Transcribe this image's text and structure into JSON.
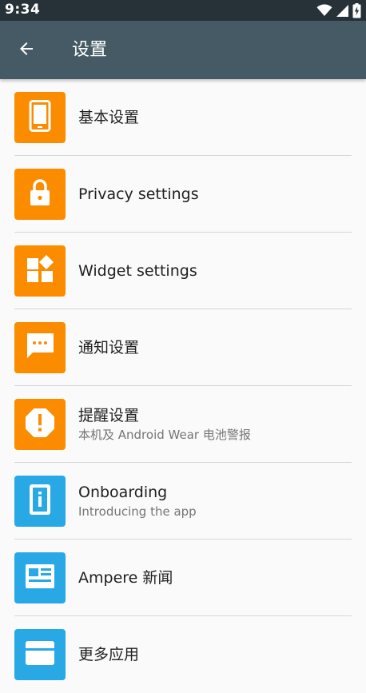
{
  "status_bar": {
    "time": "9:34",
    "icons": [
      "wifi-icon",
      "cell-signal-icon",
      "battery-charging-icon"
    ]
  },
  "app_bar": {
    "title": "设置",
    "back_icon": "arrow-back-icon"
  },
  "colors": {
    "status_bar": "#263238",
    "app_bar": "#455a64",
    "orange_tile": "#fb8c00",
    "blue_tile": "#29a8e6",
    "background": "#fafafa"
  },
  "items": [
    {
      "title": "基本设置",
      "subtitle": "",
      "icon": "phone-icon",
      "tile_color": "#fb8c00"
    },
    {
      "title": "Privacy settings",
      "subtitle": "",
      "icon": "lock-icon",
      "tile_color": "#fb8c00"
    },
    {
      "title": "Widget settings",
      "subtitle": "",
      "icon": "widgets-icon",
      "tile_color": "#fb8c00"
    },
    {
      "title": "通知设置",
      "subtitle": "",
      "icon": "chat-bubble-icon",
      "tile_color": "#fb8c00"
    },
    {
      "title": "提醒设置",
      "subtitle": "本机及 Android Wear 电池警报",
      "icon": "alert-octagon-icon",
      "tile_color": "#fb8c00"
    },
    {
      "title": "Onboarding",
      "subtitle": "Introducing the app",
      "icon": "info-phone-icon",
      "tile_color": "#29a8e6"
    },
    {
      "title": "Ampere 新闻",
      "subtitle": "",
      "icon": "news-icon",
      "tile_color": "#29a8e6"
    },
    {
      "title": "更多应用",
      "subtitle": "",
      "icon": "apps-icon",
      "tile_color": "#29a8e6"
    }
  ]
}
